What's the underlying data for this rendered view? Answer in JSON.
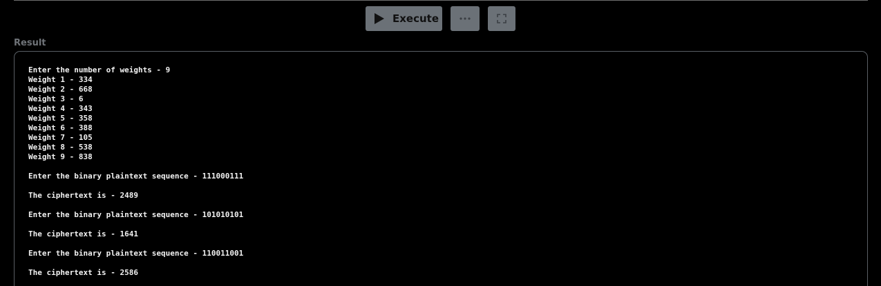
{
  "toolbar": {
    "execute_label": "Execute",
    "execute_icon": "play-icon",
    "more_icon": "ellipsis-icon",
    "expand_icon": "fullscreen-icon"
  },
  "result": {
    "label": "Result",
    "lines": [
      "Enter the number of weights - 9",
      "Weight 1 - 334",
      "Weight 2 - 668",
      "Weight 3 - 6",
      "Weight 4 - 343",
      "Weight 5 - 358",
      "Weight 6 - 388",
      "Weight 7 - 105",
      "Weight 8 - 538",
      "Weight 9 - 838",
      "",
      "Enter the binary plaintext sequence - 111000111",
      "",
      "The ciphertext is - 2489",
      "",
      "Enter the binary plaintext sequence - 101010101",
      "",
      "The ciphertext is - 1641",
      "",
      "Enter the binary plaintext sequence - 110011001",
      "",
      "The ciphertext is - 2586"
    ]
  },
  "colors": {
    "background": "#000000",
    "button": "#6b7177",
    "text": "#f2f2f2",
    "label": "#6f7378",
    "border": "#5a5f65"
  }
}
